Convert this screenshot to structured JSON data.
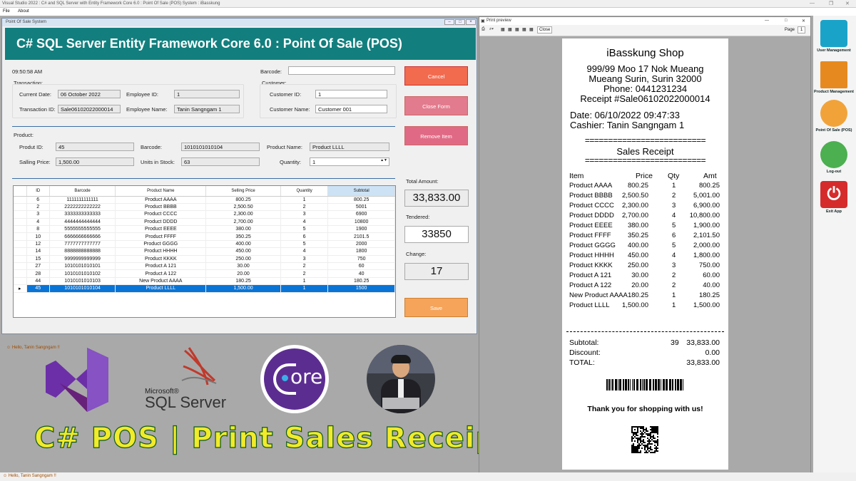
{
  "outer": {
    "title": "Visual Studio 2022 : C# and SQL Server with Entity Framework Core 6.0 : Point Of Sale (POS) System : iBasskung",
    "menu": [
      "File",
      "About"
    ],
    "status": "Hello, Tanin Sangngam !!"
  },
  "pos": {
    "window_title": "Point Of Sale System",
    "header": "C# SQL Server Entity Framework Core 6.0 : Point Of Sale (POS)",
    "time": "09:50:58 AM",
    "barcode_label": "Barcode:",
    "barcode_value": "",
    "transaction": {
      "group": "Transaction:",
      "current_date_label": "Current Date:",
      "current_date": "06 October 2022",
      "employee_id_label": "Employee ID:",
      "employee_id": "1",
      "transaction_id_label": "Transaction ID:",
      "transaction_id": "Sale06102022000014",
      "employee_name_label": "Employee Name:",
      "employee_name": "Tanin Sangngam 1"
    },
    "customer": {
      "group": "Customer:",
      "id_label": "Customer ID:",
      "id": "1",
      "name_label": "Customer Name:",
      "name": "Customer 001"
    },
    "product": {
      "group": "Product:",
      "id_label": "Produt ID:",
      "id": "45",
      "barcode_label": "Barcode:",
      "barcode": "1010101010104",
      "name_label": "Product Name:",
      "name": "Product LLLL",
      "price_label": "Salling Price:",
      "price": "1,500.00",
      "stock_label": "Units in Stock:",
      "stock": "63",
      "qty_label": "Quantity:",
      "qty": "1"
    },
    "buttons": {
      "cancel": "Cancel",
      "close_form": "Close Form",
      "remove_item": "Remove Item",
      "save": "Save"
    },
    "totals": {
      "total_label": "Total Amount:",
      "total": "33,833.00",
      "tendered_label": "Tendered:",
      "tendered": "33850",
      "change_label": "Change:",
      "change": "17"
    },
    "grid": {
      "columns": [
        "ID",
        "Barcode",
        "Product Name",
        "Selling Price",
        "Quantity",
        "Subtotal"
      ],
      "rows": [
        [
          "6",
          "1111111111111",
          "Product AAAA",
          "800.25",
          "1",
          "800.25"
        ],
        [
          "2",
          "2222222222222",
          "Product BBBB",
          "2,500.50",
          "2",
          "5001"
        ],
        [
          "3",
          "3333333333333",
          "Product CCCC",
          "2,300.00",
          "3",
          "6900"
        ],
        [
          "4",
          "4444444444444",
          "Product DDDD",
          "2,700.00",
          "4",
          "10800"
        ],
        [
          "8",
          "5555555555555",
          "Product EEEE",
          "380.00",
          "5",
          "1900"
        ],
        [
          "10",
          "6666666666666",
          "Product FFFF",
          "350.25",
          "6",
          "2101.5"
        ],
        [
          "12",
          "7777777777777",
          "Product GGGG",
          "400.00",
          "5",
          "2000"
        ],
        [
          "14",
          "8888888888888",
          "Product HHHH",
          "450.00",
          "4",
          "1800"
        ],
        [
          "15",
          "9999999999999",
          "Product KKKK",
          "250.00",
          "3",
          "750"
        ],
        [
          "27",
          "1010101010101",
          "Product A 121",
          "30.00",
          "2",
          "60"
        ],
        [
          "28",
          "1010101010102",
          "Product A 122",
          "20.00",
          "2",
          "40"
        ],
        [
          "44",
          "1010101010103",
          "New Product AAAA",
          "180.25",
          "1",
          "180.25"
        ],
        [
          "45",
          "1010101010104",
          "Product LLLL",
          "1,500.00",
          "1",
          "1500"
        ]
      ],
      "selected_row": 12,
      "row_marker": "▸"
    },
    "status": "Hello, Tanin Sangngam !!"
  },
  "preview": {
    "title": "Print preview",
    "close": "Close",
    "page_label": "Page",
    "page": "1",
    "receipt": {
      "shop": "iBasskung Shop",
      "address1": "999/99 Moo 17 Nok Mueang",
      "address2": "Mueang Surin, Surin 32000",
      "phone": "Phone: 0441231234",
      "receipt_no": "Receipt #Sale06102022000014",
      "date": "Date: 06/10/2022 09:47:33",
      "cashier": "Cashier: Tanin Sangngam 1",
      "rule": "==========================",
      "heading": "Sales Receipt",
      "columns": [
        "Item",
        "Price",
        "Qty",
        "Amt"
      ],
      "items": [
        [
          "Product AAAA",
          "800.25",
          "1",
          "800.25"
        ],
        [
          "Product BBBB",
          "2,500.50",
          "2",
          "5,001.00"
        ],
        [
          "Product CCCC",
          "2,300.00",
          "3",
          "6,900.00"
        ],
        [
          "Product DDDD",
          "2,700.00",
          "4",
          "10,800.00"
        ],
        [
          "Product EEEE",
          "380.00",
          "5",
          "1,900.00"
        ],
        [
          "Product FFFF",
          "350.25",
          "6",
          "2,101.50"
        ],
        [
          "Product GGGG",
          "400.00",
          "5",
          "2,000.00"
        ],
        [
          "Product HHHH",
          "450.00",
          "4",
          "1,800.00"
        ],
        [
          "Product KKKK",
          "250.00",
          "3",
          "750.00"
        ],
        [
          "Product A 121",
          "30.00",
          "2",
          "60.00"
        ],
        [
          "Product A 122",
          "20.00",
          "2",
          "40.00"
        ],
        [
          "New Product AAAA",
          "180.25",
          "1",
          "180.25"
        ],
        [
          "Product LLLL",
          "1,500.00",
          "1",
          "1,500.00"
        ]
      ],
      "subtotal_label": "Subtotal:",
      "subtotal_qty": "39",
      "subtotal": "33,833.00",
      "discount_label": "Discount:",
      "discount": "0.00",
      "total_label": "TOTAL:",
      "total": "33,833.00",
      "thanks": "Thank you for shopping with us!"
    }
  },
  "rail": [
    {
      "label": "User Management",
      "color": "#1aa3c9"
    },
    {
      "label": "Product Management",
      "color": "#e68a1f"
    },
    {
      "label": "Point Of Sale (POS)",
      "color": "#f1a33a"
    },
    {
      "label": "Log-out",
      "color": "#4caf50"
    },
    {
      "label": "Exit App",
      "color": "#d62b2b"
    }
  ],
  "logos": {
    "sql_small": "Microsoft®",
    "sql_big": "SQL Server",
    "core": "ore"
  },
  "banner": "C# POS | Print Sales Receipt",
  "colors": {
    "header": "#127f7e",
    "cancel": "#f26b4f",
    "close_form": "#e27b8d",
    "remove_item": "#e06a85",
    "save": "#f5a45a",
    "selected_row": "#0a74d6",
    "banner_text": "#f2ea2a"
  }
}
